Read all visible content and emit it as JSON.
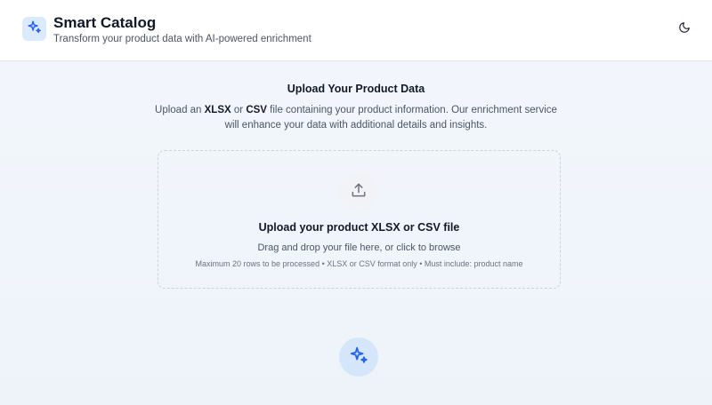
{
  "header": {
    "title": "Smart Catalog",
    "subtitle": "Transform your product data with AI-powered enrichment",
    "logo_icon": "sparkles-icon",
    "theme_toggle_icon": "moon-icon"
  },
  "upload_section": {
    "title": "Upload Your Product Data",
    "description": {
      "prefix": "Upload an ",
      "format1": "XLSX",
      "middle": " or ",
      "format2": "CSV",
      "suffix": " file containing your product information. Our enrichment service will enhance your data with additional details and insights."
    }
  },
  "dropzone": {
    "icon": "upload-icon",
    "title": "Upload your product XLSX or CSV file",
    "hint": "Drag and drop your file here, or click to browse",
    "note": "Maximum 20 rows to be processed • XLSX or CSV format only • Must include: product name"
  },
  "fab": {
    "icon": "sparkles-icon"
  },
  "colors": {
    "accent": "#2563eb",
    "accent_light": "#dbeafe",
    "background": "#f3f7fc"
  }
}
